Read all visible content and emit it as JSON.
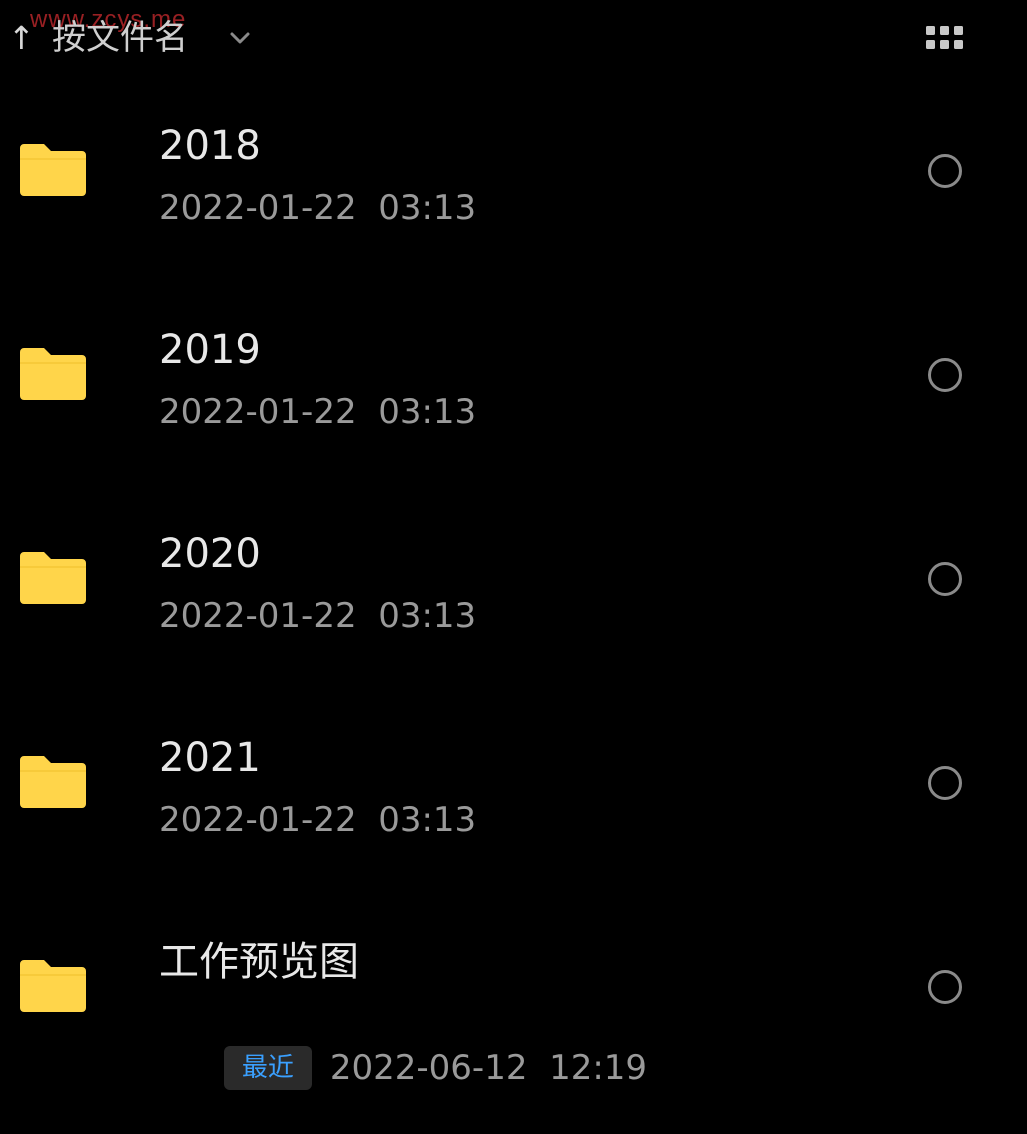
{
  "watermark": "www.zcys.me",
  "sort": {
    "arrow": "↑",
    "label": "按文件名",
    "chevron_icon": "chevron-down-icon",
    "view_icon": "grid-view-icon"
  },
  "colors": {
    "background": "#000000",
    "folder": "#FFD54A",
    "recent_badge_text": "#3AA0FF"
  },
  "items": [
    {
      "name": "2018",
      "date": "2022-01-22  03:13",
      "badge": ""
    },
    {
      "name": "2019",
      "date": "2022-01-22  03:13",
      "badge": ""
    },
    {
      "name": "2020",
      "date": "2022-01-22  03:13",
      "badge": ""
    },
    {
      "name": "2021",
      "date": "2022-01-22  03:13",
      "badge": ""
    },
    {
      "name": "工作预览图",
      "date": "2022-06-12  12:19",
      "badge": "最近"
    }
  ]
}
